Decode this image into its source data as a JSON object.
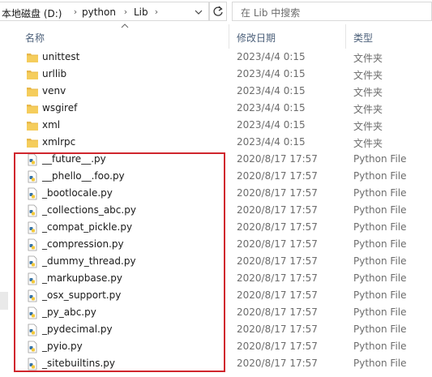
{
  "address": {
    "crumbs": [
      "本地磁盘 (D:)",
      "python",
      "Lib"
    ],
    "refresh_icon": "refresh-icon"
  },
  "search": {
    "placeholder": "在 Lib 中搜索"
  },
  "columns": {
    "name": "名称",
    "date": "修改日期",
    "type": "类型"
  },
  "folders": [
    {
      "name": "unittest",
      "date": "2023/4/4 0:15",
      "type": "文件夹"
    },
    {
      "name": "urllib",
      "date": "2023/4/4 0:15",
      "type": "文件夹"
    },
    {
      "name": "venv",
      "date": "2023/4/4 0:15",
      "type": "文件夹"
    },
    {
      "name": "wsgiref",
      "date": "2023/4/4 0:15",
      "type": "文件夹"
    },
    {
      "name": "xml",
      "date": "2023/4/4 0:15",
      "type": "文件夹"
    },
    {
      "name": "xmlrpc",
      "date": "2023/4/4 0:15",
      "type": "文件夹"
    }
  ],
  "files": [
    {
      "name": "__future__.py",
      "date": "2020/8/17 17:57",
      "type": "Python File"
    },
    {
      "name": "__phello__.foo.py",
      "date": "2020/8/17 17:57",
      "type": "Python File"
    },
    {
      "name": "_bootlocale.py",
      "date": "2020/8/17 17:57",
      "type": "Python File"
    },
    {
      "name": "_collections_abc.py",
      "date": "2020/8/17 17:57",
      "type": "Python File"
    },
    {
      "name": "_compat_pickle.py",
      "date": "2020/8/17 17:57",
      "type": "Python File"
    },
    {
      "name": "_compression.py",
      "date": "2020/8/17 17:57",
      "type": "Python File"
    },
    {
      "name": "_dummy_thread.py",
      "date": "2020/8/17 17:57",
      "type": "Python File"
    },
    {
      "name": "_markupbase.py",
      "date": "2020/8/17 17:57",
      "type": "Python File"
    },
    {
      "name": "_osx_support.py",
      "date": "2020/8/17 17:57",
      "type": "Python File"
    },
    {
      "name": "_py_abc.py",
      "date": "2020/8/17 17:57",
      "type": "Python File"
    },
    {
      "name": "_pydecimal.py",
      "date": "2020/8/17 17:57",
      "type": "Python File"
    },
    {
      "name": "_pyio.py",
      "date": "2020/8/17 17:57",
      "type": "Python File"
    },
    {
      "name": "_sitebuiltins.py",
      "date": "2020/8/17 17:57",
      "type": "Python File"
    }
  ],
  "colors": {
    "highlight": "#d0262d",
    "folder": "#e8b84a",
    "header_text": "#4c607a"
  }
}
